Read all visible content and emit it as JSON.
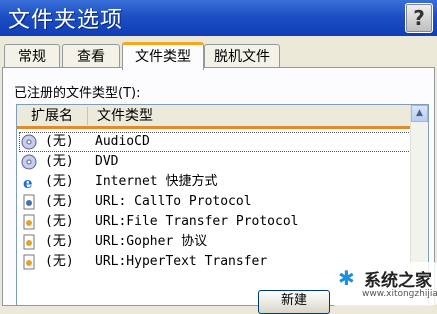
{
  "window": {
    "title": "文件夹选项",
    "help_label": "?"
  },
  "tabs": [
    {
      "label": "常规",
      "active": false
    },
    {
      "label": "查看",
      "active": false
    },
    {
      "label": "文件类型",
      "active": true
    },
    {
      "label": "脱机文件",
      "active": false
    }
  ],
  "section": {
    "label": "已注册的文件类型(T):"
  },
  "columns": {
    "ext": "扩展名",
    "type": "文件类型"
  },
  "rows": [
    {
      "icon": "audio-cd-icon",
      "ext": "(无)",
      "type": "AudioCD"
    },
    {
      "icon": "dvd-icon",
      "ext": "(无)",
      "type": "DVD"
    },
    {
      "icon": "ie-icon",
      "ext": "(无)",
      "type": "Internet 快捷方式"
    },
    {
      "icon": "url-icon",
      "ext": "(无)",
      "type": "URL: CallTo Protocol"
    },
    {
      "icon": "url-icon",
      "ext": "(无)",
      "type": "URL:File Transfer Protocol"
    },
    {
      "icon": "url-icon",
      "ext": "(无)",
      "type": "URL:Gopher 协议"
    },
    {
      "icon": "url-icon",
      "ext": "(无)",
      "type": "URL:HyperText Transfer"
    }
  ],
  "buttons": {
    "new_label": "新建"
  },
  "watermark": {
    "brand": "系统之家",
    "url": "www.xitongzhijia.net"
  }
}
